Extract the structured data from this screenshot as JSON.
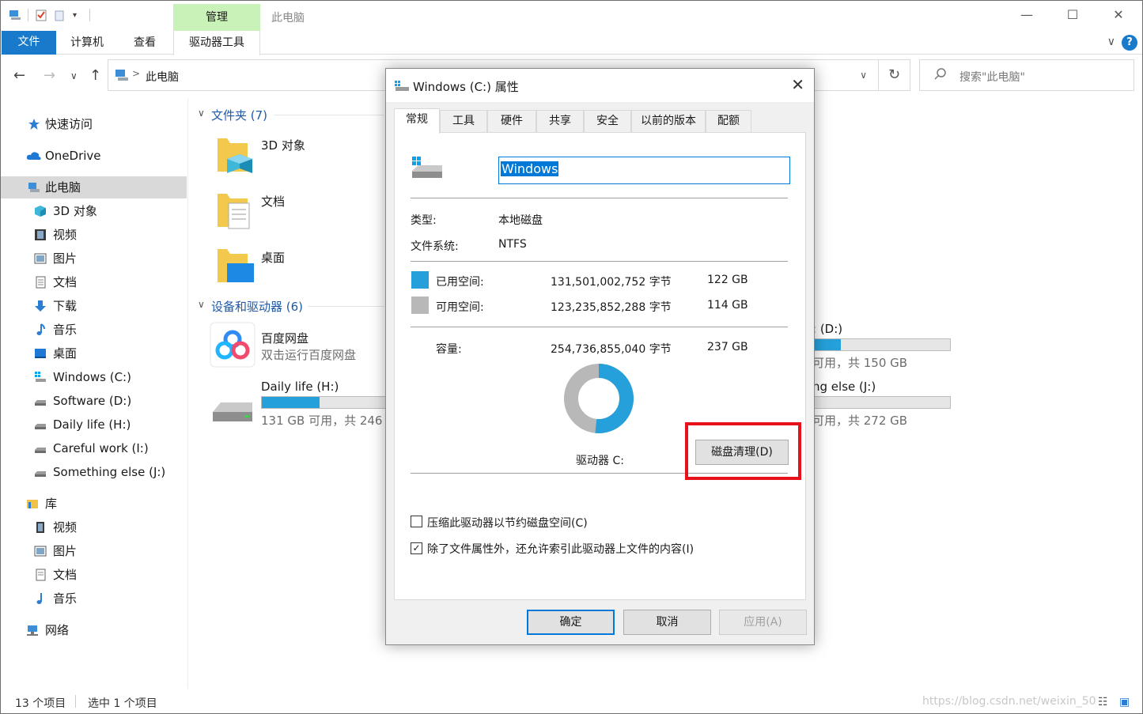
{
  "titlebar": {
    "manage_tab": "管理",
    "window_title": "此电脑"
  },
  "ribbon": {
    "file": "文件",
    "computer": "计算机",
    "view": "查看",
    "drive_tools": "驱动器工具",
    "help": "?"
  },
  "address": {
    "crumb": "此电脑",
    "search_placeholder": "搜索\"此电脑\""
  },
  "sidebar": {
    "quick_access": "快速访问",
    "onedrive": "OneDrive",
    "this_pc": "此电脑",
    "pc_items": [
      "3D 对象",
      "视频",
      "图片",
      "文档",
      "下载",
      "音乐",
      "桌面",
      "Windows (C:)",
      "Software (D:)",
      "Daily life (H:)",
      "Careful work (I:)",
      "Something else (J:)"
    ],
    "library": "库",
    "lib_items": [
      "视频",
      "图片",
      "文档",
      "音乐"
    ],
    "network": "网络"
  },
  "content": {
    "folders_header": "文件夹 (7)",
    "folders": [
      "3D 对象",
      "文档",
      "桌面"
    ],
    "devices_header": "设备和驱动器 (6)",
    "baidu_name": "百度网盘",
    "baidu_sub": "双击运行百度网盘",
    "daily_name": "Daily life (H:)",
    "daily_sub": "131 GB 可用，共 246 G",
    "daily_fill": 0.47,
    "software_name": ": (D:)",
    "software_sub": "可用，共 150 GB",
    "software_fill": 0.2,
    "something_name": "ng else (J:)",
    "something_sub": "可用，共 272 GB",
    "something_fill": 0.0
  },
  "status": {
    "count": "13 个项目",
    "selected": "选中 1 个项目",
    "watermark": "https://blog.csdn.net/weixin_50"
  },
  "dialog": {
    "title": "Windows (C:) 属性",
    "tabs": [
      "常规",
      "工具",
      "硬件",
      "共享",
      "安全",
      "以前的版本",
      "配额"
    ],
    "name_value": "Windows",
    "type_label": "类型:",
    "type_value": "本地磁盘",
    "fs_label": "文件系统:",
    "fs_value": "NTFS",
    "used_label": "已用空间:",
    "used_bytes": "131,501,002,752 字节",
    "used_gb": "122 GB",
    "free_label": "可用空间:",
    "free_bytes": "123,235,852,288 字节",
    "free_gb": "114 GB",
    "cap_label": "容量:",
    "cap_bytes": "254,736,855,040 字节",
    "cap_gb": "237 GB",
    "used_fraction": 0.516,
    "drive_label": "驱动器 C:",
    "cleanup_button": "磁盘清理(D)",
    "compress_label": "压缩此驱动器以节约磁盘空间(C)",
    "compress_checked": false,
    "index_label": "除了文件属性外，还允许索引此驱动器上文件的内容(I)",
    "index_checked": true,
    "ok": "确定",
    "cancel": "取消",
    "apply": "应用(A)",
    "colors": {
      "used": "#26a0da",
      "free": "#b8b8b8"
    }
  }
}
